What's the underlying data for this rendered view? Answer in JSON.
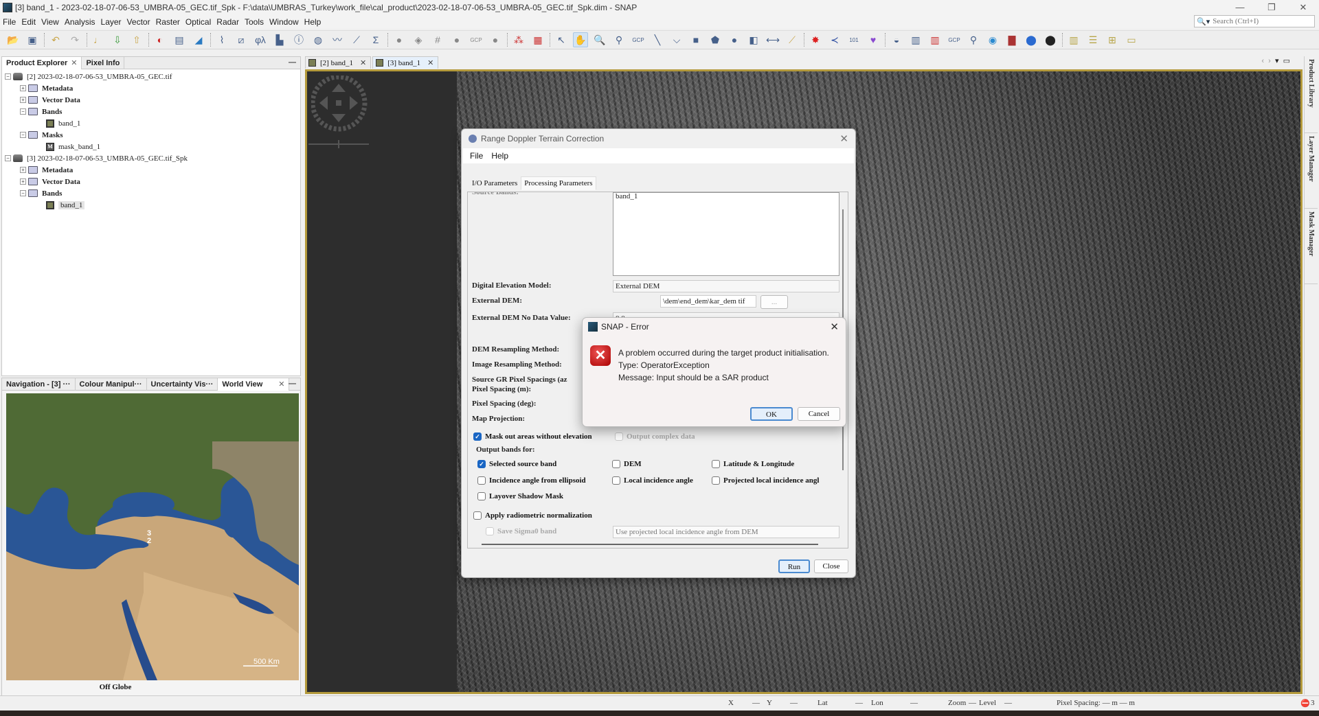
{
  "window": {
    "title": "[3] band_1 - 2023-02-18-07-06-53_UMBRA-05_GEC.tif_Spk - F:\\data\\UMBRAS_Turkey\\work_file\\cal_product\\2023-02-18-07-06-53_UMBRA-05_GEC.tif_Spk.dim - SNAP",
    "minimize": "—",
    "restore": "❐",
    "close": "✕"
  },
  "menu": [
    "File",
    "Edit",
    "View",
    "Analysis",
    "Layer",
    "Vector",
    "Raster",
    "Optical",
    "Radar",
    "Tools",
    "Window",
    "Help"
  ],
  "search": {
    "placeholder": "Search (Ctrl+I)",
    "icon": "search-icon"
  },
  "toolbar": {
    "groups": [
      [
        "open-product",
        "save-product"
      ],
      [
        "undo",
        "redo"
      ],
      [
        "band-maths",
        "import",
        "export"
      ],
      [
        "rgb-image",
        "colour-manip",
        "layer"
      ],
      [
        "spectrum",
        "geometry",
        "phi-lambda",
        "histogram",
        "info",
        "profile",
        "plot",
        "scatter",
        "sum"
      ],
      [
        "gcp-tool",
        "mask",
        "grid",
        "pin",
        "gcp-manager",
        "range"
      ],
      [
        "graph-builder",
        "batch"
      ],
      [
        "select",
        "pan",
        "zoom",
        "pin-placing",
        "gcp-placing",
        "line",
        "polyline",
        "rectangle",
        "polygon",
        "ellipse",
        "insert-figure",
        "measure",
        "magic-wand"
      ],
      [
        "star",
        "xy",
        "binary",
        "cluster"
      ],
      [
        "dem",
        "layer-stack",
        "coregister",
        "gcp-export",
        "find",
        "eye",
        "spectral",
        "globe",
        "sphere"
      ],
      [
        "tile-vertical",
        "tile-horizontal",
        "tile-evenly",
        "single-window"
      ]
    ],
    "active": "pan"
  },
  "product_explorer": {
    "tabs": [
      {
        "label": "Product Explorer",
        "closable": true
      },
      {
        "label": "Pixel Info",
        "closable": false
      }
    ],
    "tree": [
      {
        "level": 0,
        "toggle": "−",
        "icon": "db",
        "label": "[2] 2023-02-18-07-06-53_UMBRA-05_GEC.tif"
      },
      {
        "level": 1,
        "toggle": "+",
        "icon": "folder",
        "label": "Metadata"
      },
      {
        "level": 1,
        "toggle": "+",
        "icon": "folder",
        "label": "Vector Data"
      },
      {
        "level": 1,
        "toggle": "−",
        "icon": "folder",
        "label": "Bands"
      },
      {
        "level": 2,
        "toggle": "",
        "icon": "band",
        "label": "band_1"
      },
      {
        "level": 1,
        "toggle": "−",
        "icon": "folder",
        "label": "Masks"
      },
      {
        "level": 2,
        "toggle": "",
        "icon": "mask",
        "label": "mask_band_1"
      },
      {
        "level": 0,
        "toggle": "−",
        "icon": "db",
        "label": "[3] 2023-02-18-07-06-53_UMBRA-05_GEC.tif_Spk"
      },
      {
        "level": 1,
        "toggle": "+",
        "icon": "folder",
        "label": "Metadata"
      },
      {
        "level": 1,
        "toggle": "+",
        "icon": "folder",
        "label": "Vector Data"
      },
      {
        "level": 1,
        "toggle": "−",
        "icon": "folder",
        "label": "Bands"
      },
      {
        "level": 2,
        "toggle": "",
        "icon": "band",
        "label": "band_1",
        "selected": true
      }
    ]
  },
  "nav_panel": {
    "tabs": [
      "Navigation - [3] ···",
      "Colour Manipul···",
      "Uncertainty Vis···",
      "World View"
    ],
    "active_tab": "World View",
    "map_markers": [
      "3",
      "2"
    ],
    "scale_label": "500 Km",
    "status": "Off Globe"
  },
  "editor": {
    "tabs": [
      {
        "label": "[2] band_1",
        "active": false
      },
      {
        "label": "[3] band_1",
        "active": true
      }
    ],
    "controls": [
      "‹",
      "›",
      "▾",
      "▭"
    ]
  },
  "right_strip": [
    "Product Library",
    "Layer Manager",
    "Mask Manager"
  ],
  "rd_dialog": {
    "title": "Range Doppler Terrain Correction",
    "menus": [
      "File",
      "Help"
    ],
    "tabs": [
      "I/O Parameters",
      "Processing Parameters"
    ],
    "active_tab": "Processing Parameters",
    "source_bands_label": "Source Bands:",
    "source_bands": [
      "band_1"
    ],
    "dem_label": "Digital Elevation Model:",
    "dem_value": "External DEM",
    "ext_dem_label": "External DEM:",
    "ext_dem_value": "\\dem\\end_dem\\kar_dem tif",
    "browse": "...",
    "nodata_label": "External DEM No Data Value:",
    "nodata_value": "0.0",
    "dem_resampling_label": "DEM Resampling Method:",
    "img_resampling_label": "Image Resampling Method:",
    "source_gr_label": "Source GR Pixel Spacings (az",
    "pixel_spacing_m_label": "Pixel Spacing (m):",
    "pixel_spacing_deg_label": "Pixel Spacing (deg):",
    "map_projection_label": "Map Projection:",
    "mask_out": {
      "label": "Mask out areas without elevation",
      "checked": true
    },
    "output_complex": {
      "label": "Output complex data",
      "checked": false,
      "disabled": true
    },
    "output_bands_label": "Output bands for:",
    "output_bands": [
      {
        "label": "Selected source band",
        "checked": true
      },
      {
        "label": "DEM",
        "checked": false
      },
      {
        "label": "Latitude & Longitude",
        "checked": false
      },
      {
        "label": "Incidence angle from ellipsoid",
        "checked": false
      },
      {
        "label": "Local incidence angle",
        "checked": false
      },
      {
        "label": "Projected local incidence angl",
        "checked": false
      },
      {
        "label": "Layover Shadow Mask",
        "checked": false
      }
    ],
    "radiometric": {
      "label": "Apply radiometric normalization",
      "checked": false
    },
    "save_sigma0": {
      "label": "Save Sigma0 band",
      "checked": false,
      "disabled": true
    },
    "incidence_source": "Use projected local incidence angle from DEM",
    "run": "Run",
    "close": "Close"
  },
  "error_dialog": {
    "title": "SNAP - Error",
    "lines": [
      "A problem occurred during the target product initialisation.",
      "Type: OperatorException",
      "Message: Input should be a SAR product"
    ],
    "ok": "OK",
    "cancel": "Cancel"
  },
  "statusbar": {
    "x_label": "X",
    "x_val": "—",
    "y_label": "Y",
    "y_val": "—",
    "lat_label": "Lat",
    "lat_val": "—",
    "lon_label": "Lon",
    "lon_val": "—",
    "zoom_label": "Zoom",
    "zoom_val": "—",
    "level_label": "Level",
    "level_val": "—",
    "pixel_spacing": "Pixel Spacing: — m — m",
    "notifications": "3"
  }
}
